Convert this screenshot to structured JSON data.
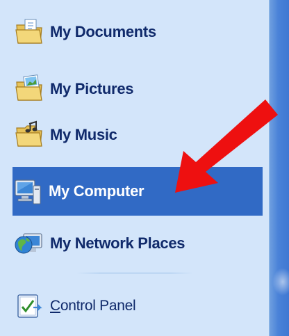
{
  "menu": {
    "items": [
      {
        "label": "My Documents",
        "icon": "my-documents-folder-icon"
      },
      {
        "label": "My Pictures",
        "icon": "my-pictures-folder-icon"
      },
      {
        "label": "My Music",
        "icon": "my-music-folder-icon"
      },
      {
        "label": "My Computer",
        "icon": "my-computer-icon",
        "selected": true
      },
      {
        "label": "My Network Places",
        "icon": "network-globe-icon"
      },
      {
        "label": "Control Panel",
        "icon": "control-panel-icon",
        "mnemonic": "C"
      }
    ]
  },
  "annotation": {
    "type": "arrow",
    "color": "#ee1010"
  },
  "colors": {
    "panel_background": "#d3e5fa",
    "selection": "#316ac5",
    "text": "#102a6b",
    "edge": "#4a82d8"
  }
}
